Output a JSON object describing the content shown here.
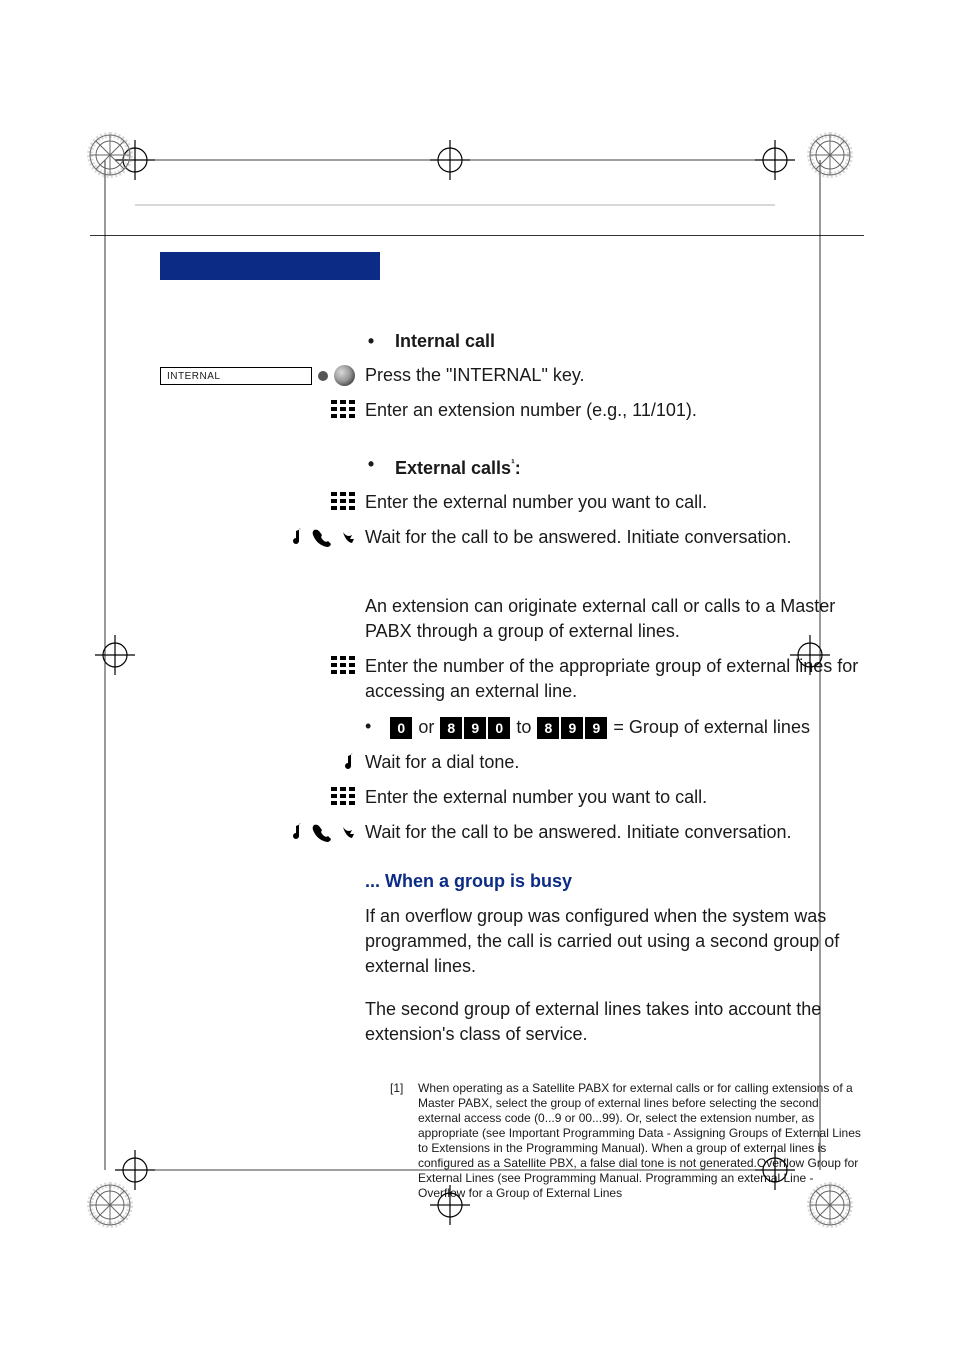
{
  "section_internal": {
    "heading": "Internal call",
    "steps": [
      {
        "softkey_label": "INTERNAL",
        "text": "Press the \"INTERNAL\" key."
      },
      {
        "icon": "keypad",
        "text": "Enter an extension number (e.g., 11/101)."
      }
    ]
  },
  "section_external": {
    "heading": "External calls",
    "heading_footnote_marker": "¹",
    "heading_suffix": ":",
    "steps": [
      {
        "icon": "keypad",
        "text": "Enter the external number you want to call."
      },
      {
        "icon": "answered",
        "text": "Wait for the call to be answered. Initiate conversation."
      }
    ],
    "intro_para": "An extension can originate external call or calls to a Master PABX through a group of external lines.",
    "steps2": [
      {
        "icon": "keypad",
        "text": "Enter the number of the appropriate group of external lines for accessing an external line."
      }
    ],
    "group_line": {
      "prefix_keys_a": [
        "0"
      ],
      "or_word": " or ",
      "prefix_keys_b": [
        "8",
        "9",
        "0"
      ],
      "to_word": " to ",
      "prefix_keys_c": [
        "8",
        "9",
        "9"
      ],
      "suffix": " = Group of external lines"
    },
    "steps3": [
      {
        "icon": "note",
        "text": "Wait for a dial tone."
      },
      {
        "icon": "keypad",
        "text": "Enter the external number you want to call."
      },
      {
        "icon": "answered",
        "text": "Wait for the call to be answered. Initiate conversation."
      }
    ]
  },
  "section_busy": {
    "heading": "... When a group is busy",
    "para1": "If an overflow group was configured when the system was programmed, the call is carried out using a second group of external lines.",
    "para2": "The second group of external lines takes into account the extension's class of service."
  },
  "footnote": {
    "marker": "[1]",
    "body": "When operating as a Satellite PABX for external calls or for calling extensions of a Master PABX, select the group of external lines before selecting the second external access code (0...9 or 00...99). Or, select the extension number, as appropriate (see Important Programming Data - Assigning Groups of External Lines to Extensions in the Programming Manual). When a group of external lines is configured as a Satellite PBX, a false dial tone is not generated.Overflow Group for External Lines (see Programming Manual. Programming an external Line - Overflow for a Group of External Lines"
  }
}
